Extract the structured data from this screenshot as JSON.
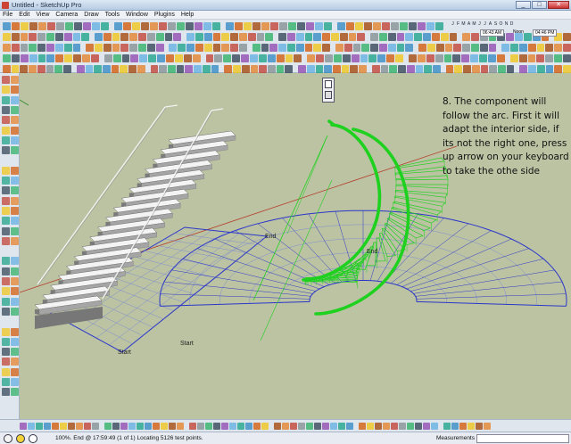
{
  "window": {
    "title": "Untitled - SketchUp Pro",
    "minimize": "_",
    "maximize": "□",
    "close": "✕"
  },
  "menu": [
    "File",
    "Edit",
    "View",
    "Camera",
    "Draw",
    "Tools",
    "Window",
    "Plugins",
    "Help"
  ],
  "shadow_toolbar": {
    "months": [
      "J",
      "F",
      "M",
      "A",
      "M",
      "J",
      "J",
      "A",
      "S",
      "O",
      "N",
      "D"
    ],
    "time_start": "06:43 AM",
    "noon": "Noon",
    "time_end": "04:46 PM"
  },
  "viewport": {
    "instruction": "8. The component will follow the arc. First it will adapt the interior side, if its not the right one, press up arrow on your keyboard to take the othe side",
    "labels": {
      "end_rect": "End",
      "end_arc": "End",
      "start_rect": "Start",
      "start_arc": "Start"
    }
  },
  "statusbar": {
    "text": "100%. End @  17:59:49 (1 of 1) Locating 5126 test points.",
    "measurements_label": "Measurements",
    "measurements_value": ""
  },
  "colors": {
    "viewport_bg": "#bcc3a3",
    "arc_green": "#1fd11f",
    "grid_blue": "#2a36c8",
    "axis_red": "#b33a2a"
  }
}
